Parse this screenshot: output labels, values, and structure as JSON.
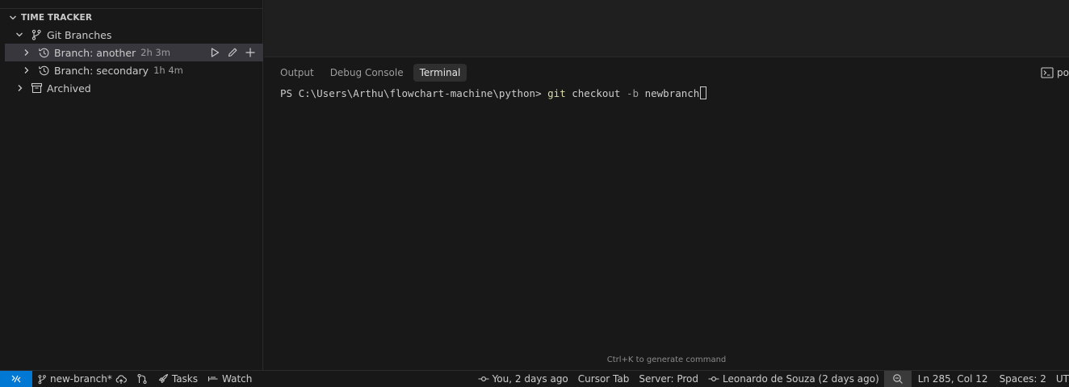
{
  "sidebar": {
    "section_title": "TIME TRACKER",
    "tree": {
      "git_branches_label": "Git Branches",
      "branches": [
        {
          "label": "Branch: another",
          "duration": "2h 3m"
        },
        {
          "label": "Branch: secondary",
          "duration": "1h 4m"
        }
      ],
      "archived_label": "Archived"
    }
  },
  "panel": {
    "tabs": [
      {
        "label": "Output"
      },
      {
        "label": "Debug Console"
      },
      {
        "label": "Terminal"
      }
    ],
    "right_label": "po",
    "terminal": {
      "prompt": "PS C:\\Users\\Arthu\\flowchart-machine\\python> ",
      "command": "git",
      "args_before": " checkout ",
      "flag": "-b",
      "args_after": " newbranch"
    },
    "hint": "Ctrl+K to generate command"
  },
  "statusbar": {
    "branch": "new-branch*",
    "tasks": "Tasks",
    "watch": "Watch",
    "blame": "You, 2 days ago",
    "cursor_tab": "Cursor Tab",
    "server": "Server: Prod",
    "author_blame": "Leonardo de Souza (2 days ago)",
    "position": "Ln 285, Col 12",
    "spaces": "Spaces: 2",
    "encoding": "UT"
  },
  "colors": {
    "remote_accent": "#0078d4",
    "command_color": "#dcdcaa",
    "selected_row": "#37373d"
  }
}
